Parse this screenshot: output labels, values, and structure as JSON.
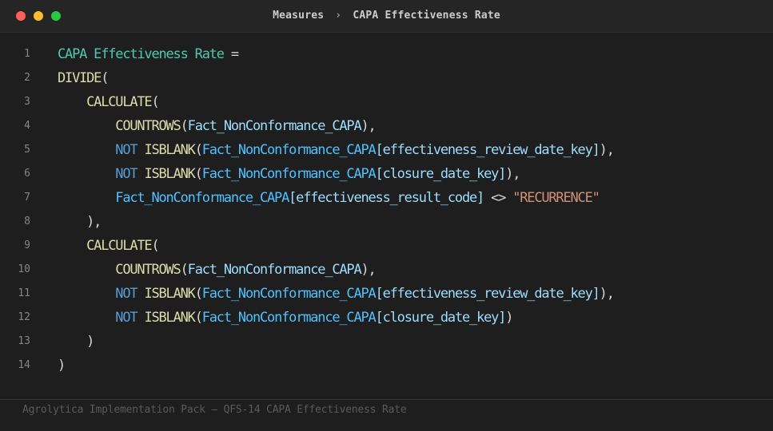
{
  "window": {
    "breadcrumb": {
      "parent": "Measures",
      "separator": "›",
      "current": "CAPA Effectiveness Rate"
    }
  },
  "editor": {
    "lines": [
      {
        "number": "1",
        "tokens": [
          {
            "t": "CAPA Effectiveness Rate",
            "c": "measure"
          },
          {
            "t": " =",
            "c": "punc"
          }
        ]
      },
      {
        "number": "2",
        "tokens": [
          {
            "t": "DIVIDE",
            "c": "fn"
          },
          {
            "t": "(",
            "c": "punc"
          }
        ]
      },
      {
        "number": "3",
        "tokens": [
          {
            "t": "    ",
            "c": "punc"
          },
          {
            "t": "CALCULATE",
            "c": "fn"
          },
          {
            "t": "(",
            "c": "punc"
          }
        ]
      },
      {
        "number": "4",
        "tokens": [
          {
            "t": "        ",
            "c": "punc"
          },
          {
            "t": "COUNTROWS",
            "c": "fn"
          },
          {
            "t": "(",
            "c": "punc"
          },
          {
            "t": "Fact_NonConformance_CAPA",
            "c": "col"
          },
          {
            "t": "),",
            "c": "punc"
          }
        ]
      },
      {
        "number": "5",
        "tokens": [
          {
            "t": "        ",
            "c": "punc"
          },
          {
            "t": "NOT",
            "c": "kw"
          },
          {
            "t": " ",
            "c": "punc"
          },
          {
            "t": "ISBLANK",
            "c": "fn"
          },
          {
            "t": "(",
            "c": "punc"
          },
          {
            "t": "Fact_NonConformance_CAPA",
            "c": "tbl"
          },
          {
            "t": "[effectiveness_review_date_key]",
            "c": "col"
          },
          {
            "t": "),",
            "c": "punc"
          }
        ]
      },
      {
        "number": "6",
        "tokens": [
          {
            "t": "        ",
            "c": "punc"
          },
          {
            "t": "NOT",
            "c": "kw"
          },
          {
            "t": " ",
            "c": "punc"
          },
          {
            "t": "ISBLANK",
            "c": "fn"
          },
          {
            "t": "(",
            "c": "punc"
          },
          {
            "t": "Fact_NonConformance_CAPA",
            "c": "tbl"
          },
          {
            "t": "[closure_date_key]",
            "c": "col"
          },
          {
            "t": "),",
            "c": "punc"
          }
        ]
      },
      {
        "number": "7",
        "tokens": [
          {
            "t": "        ",
            "c": "punc"
          },
          {
            "t": "Fact_NonConformance_CAPA",
            "c": "tbl"
          },
          {
            "t": "[effectiveness_result_code]",
            "c": "col"
          },
          {
            "t": " <> ",
            "c": "punc"
          },
          {
            "t": "\"RECURRENCE\"",
            "c": "str"
          }
        ]
      },
      {
        "number": "8",
        "tokens": [
          {
            "t": "    ),",
            "c": "punc"
          }
        ]
      },
      {
        "number": "9",
        "tokens": [
          {
            "t": "    ",
            "c": "punc"
          },
          {
            "t": "CALCULATE",
            "c": "fn"
          },
          {
            "t": "(",
            "c": "punc"
          }
        ]
      },
      {
        "number": "10",
        "tokens": [
          {
            "t": "        ",
            "c": "punc"
          },
          {
            "t": "COUNTROWS",
            "c": "fn"
          },
          {
            "t": "(",
            "c": "punc"
          },
          {
            "t": "Fact_NonConformance_CAPA",
            "c": "col"
          },
          {
            "t": "),",
            "c": "punc"
          }
        ]
      },
      {
        "number": "11",
        "tokens": [
          {
            "t": "        ",
            "c": "punc"
          },
          {
            "t": "NOT",
            "c": "kw"
          },
          {
            "t": " ",
            "c": "punc"
          },
          {
            "t": "ISBLANK",
            "c": "fn"
          },
          {
            "t": "(",
            "c": "punc"
          },
          {
            "t": "Fact_NonConformance_CAPA",
            "c": "tbl"
          },
          {
            "t": "[effectiveness_review_date_key]",
            "c": "col"
          },
          {
            "t": "),",
            "c": "punc"
          }
        ]
      },
      {
        "number": "12",
        "tokens": [
          {
            "t": "        ",
            "c": "punc"
          },
          {
            "t": "NOT",
            "c": "kw"
          },
          {
            "t": " ",
            "c": "punc"
          },
          {
            "t": "ISBLANK",
            "c": "fn"
          },
          {
            "t": "(",
            "c": "punc"
          },
          {
            "t": "Fact_NonConformance_CAPA",
            "c": "tbl"
          },
          {
            "t": "[closure_date_key]",
            "c": "col"
          },
          {
            "t": ")",
            "c": "punc"
          }
        ]
      },
      {
        "number": "13",
        "tokens": [
          {
            "t": "    )",
            "c": "punc"
          }
        ]
      },
      {
        "number": "14",
        "tokens": [
          {
            "t": ")",
            "c": "punc"
          }
        ]
      }
    ]
  },
  "footer": {
    "text": "Agrolytica Implementation Pack — QFS-14 CAPA Effectiveness Rate"
  },
  "colors": {
    "background": "#1e1e1e",
    "titlebar": "#252526",
    "measure": "#4ec9b0",
    "function": "#dcdcaa",
    "keyword": "#569cd6",
    "table": "#4fc1ff",
    "column": "#9cdcfe",
    "string": "#ce9178"
  }
}
